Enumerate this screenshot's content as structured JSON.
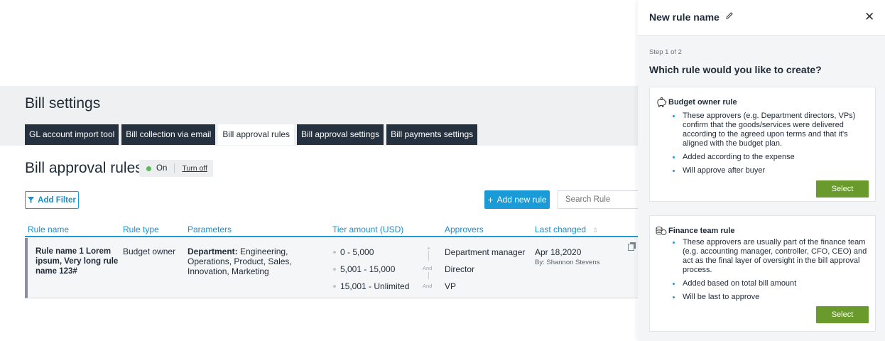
{
  "page": {
    "title": "Bill settings",
    "tabs": [
      {
        "label": "GL account import tool"
      },
      {
        "label": "Bill collection via email"
      },
      {
        "label": "Bill approval rules"
      },
      {
        "label": "Bill approval settings"
      },
      {
        "label": "Bill payments settings"
      }
    ],
    "active_tab": "Bill approval rules",
    "section_title": "Bill approval rules",
    "status": {
      "label": "On",
      "action": "Turn off",
      "color": "#5cb85c"
    }
  },
  "toolbar": {
    "filter_label": "Add Filter",
    "add_rule_label": "Add new rule",
    "search_placeholder": "Search Rule"
  },
  "table": {
    "columns": [
      "Rule name",
      "Rule type",
      "Parameters",
      "Tier amount (USD)",
      "Approvers",
      "Last changed"
    ],
    "rows": [
      {
        "rule_name": "Rule name 1 Lorem ipsum, Very long rule name 123#",
        "rule_type": "Budget owner",
        "param_label": "Department:",
        "param_value": " Engineering, Operations, Product, Sales, Innovation, Marketing",
        "tiers": [
          "0 - 5,000",
          "5,001 - 15,000",
          "15,001 - Unlimited"
        ],
        "connector": "And",
        "approvers": [
          "Department manager",
          "Director",
          "VP"
        ],
        "last_changed_date": "Apr 18,2020",
        "last_changed_by": "By: Shannon Stevens"
      }
    ]
  },
  "panel": {
    "title": "New rule name",
    "step": "Step 1 of 2",
    "question": "Which rule would you like to create?",
    "cards": [
      {
        "title": "Budget owner rule",
        "icon": "piggy-bank-icon",
        "bullets": [
          "These approvers (e.g. Department directors, VPs) confirm that the goods/services were delivered according to the agreed upon terms and that it's aligned with the budget plan.",
          "Added according to the expense",
          "Will approve after buyer"
        ],
        "button": "Select"
      },
      {
        "title": "Finance team rule",
        "icon": "coins-icon",
        "bullets": [
          "These approvers are usually part of the finance team (e.g. accounting manager, controller, CFO, CEO) and act as the final layer of oversight in the bill approval process.",
          "Added based on total bill amount",
          "Will be last to approve"
        ],
        "button": "Select"
      }
    ]
  },
  "colors": {
    "accent": "#1a9bd7",
    "tab_dark": "#26313f",
    "select_green": "#6a9a2b"
  }
}
